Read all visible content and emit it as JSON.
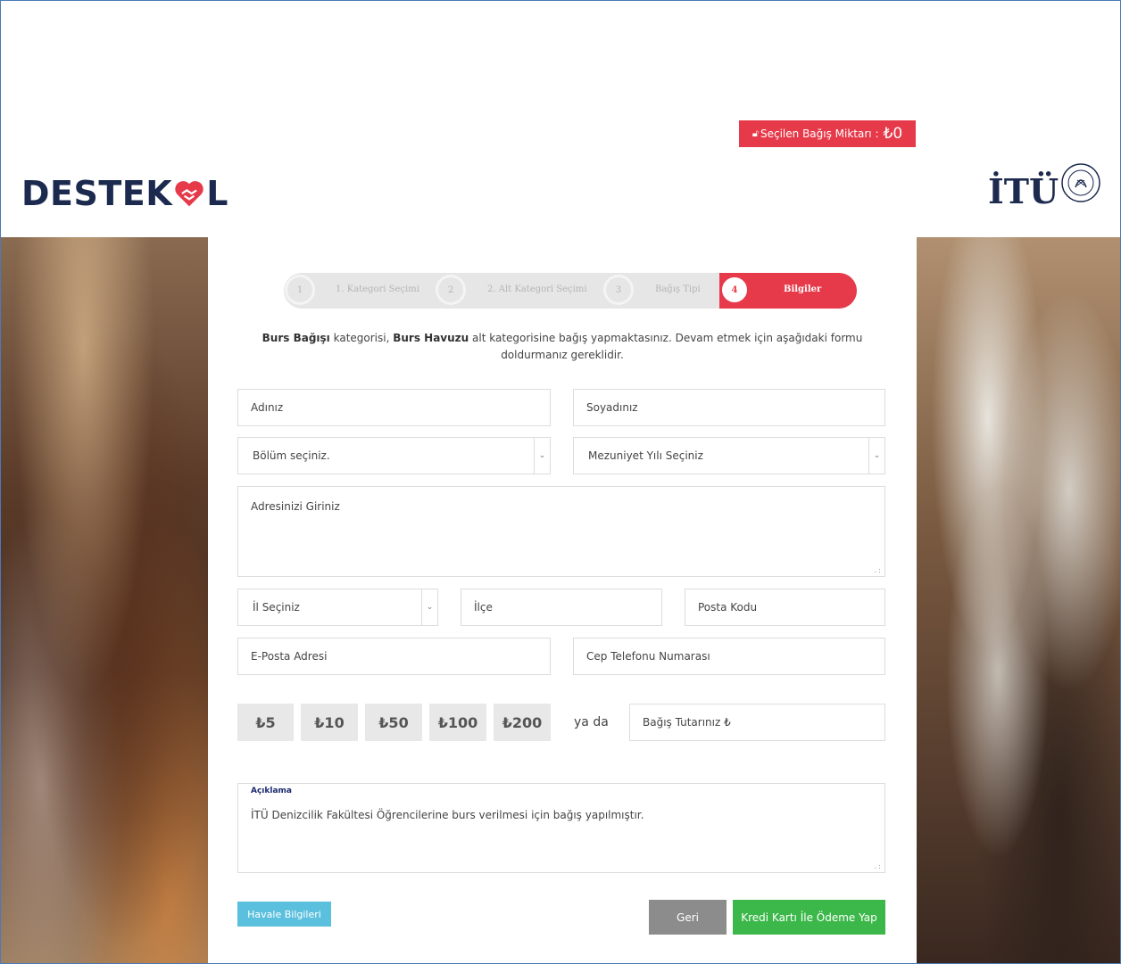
{
  "header": {
    "donation_label": "Seçilen Bağış Miktarı :",
    "donation_amount": "₺0",
    "brand_logo_text": "DESTEKOL",
    "university_logo_text": "İTÜ"
  },
  "stepper": {
    "steps": [
      {
        "num": "1",
        "label": "1. Kategori Seçimi"
      },
      {
        "num": "2",
        "label": "2. Alt Kategori Seçimi"
      },
      {
        "num": "3",
        "label": "Bağış Tipi"
      },
      {
        "num": "4",
        "label": "Bilgiler"
      }
    ]
  },
  "intro": {
    "category": "Burs Bağışı",
    "text1": " kategorisi, ",
    "subcategory": "Burs Havuzu",
    "text2": " alt kategorisine bağış yapmaktasınız. Devam etmek için aşağıdaki formu doldurmanız gereklidir."
  },
  "form": {
    "first_name_placeholder": "Adınız",
    "last_name_placeholder": "Soyadınız",
    "department_select": "Bölüm seçiniz.",
    "graduation_select": "Mezuniyet Yılı Seçiniz",
    "address_placeholder": "Adresinizi Giriniz",
    "city_select": "İl Seçiniz",
    "district_placeholder": "İlçe",
    "postal_placeholder": "Posta Kodu",
    "email_placeholder": "E-Posta Adresi",
    "phone_placeholder": "Cep Telefonu Numarası",
    "amount_options": [
      "₺5",
      "₺10",
      "₺50",
      "₺100",
      "₺200"
    ],
    "or_text": "ya da",
    "custom_amount_placeholder": "Bağış Tutarınız ₺",
    "description_label": "Açıklama",
    "description_value": "İTÜ Denizcilik Fakültesi Öğrencilerine burs verilmesi için bağış yapılmıştır."
  },
  "buttons": {
    "transfer_info": "Havale Bilgileri",
    "back": "Geri",
    "pay_card": "Kredi Kartı İle Ödeme Yap"
  },
  "colors": {
    "accent_red": "#e63a4a",
    "navy": "#1b2a4e",
    "info_blue": "#5bc0de",
    "success_green": "#3cb84a",
    "back_gray": "#8c8c8c"
  }
}
